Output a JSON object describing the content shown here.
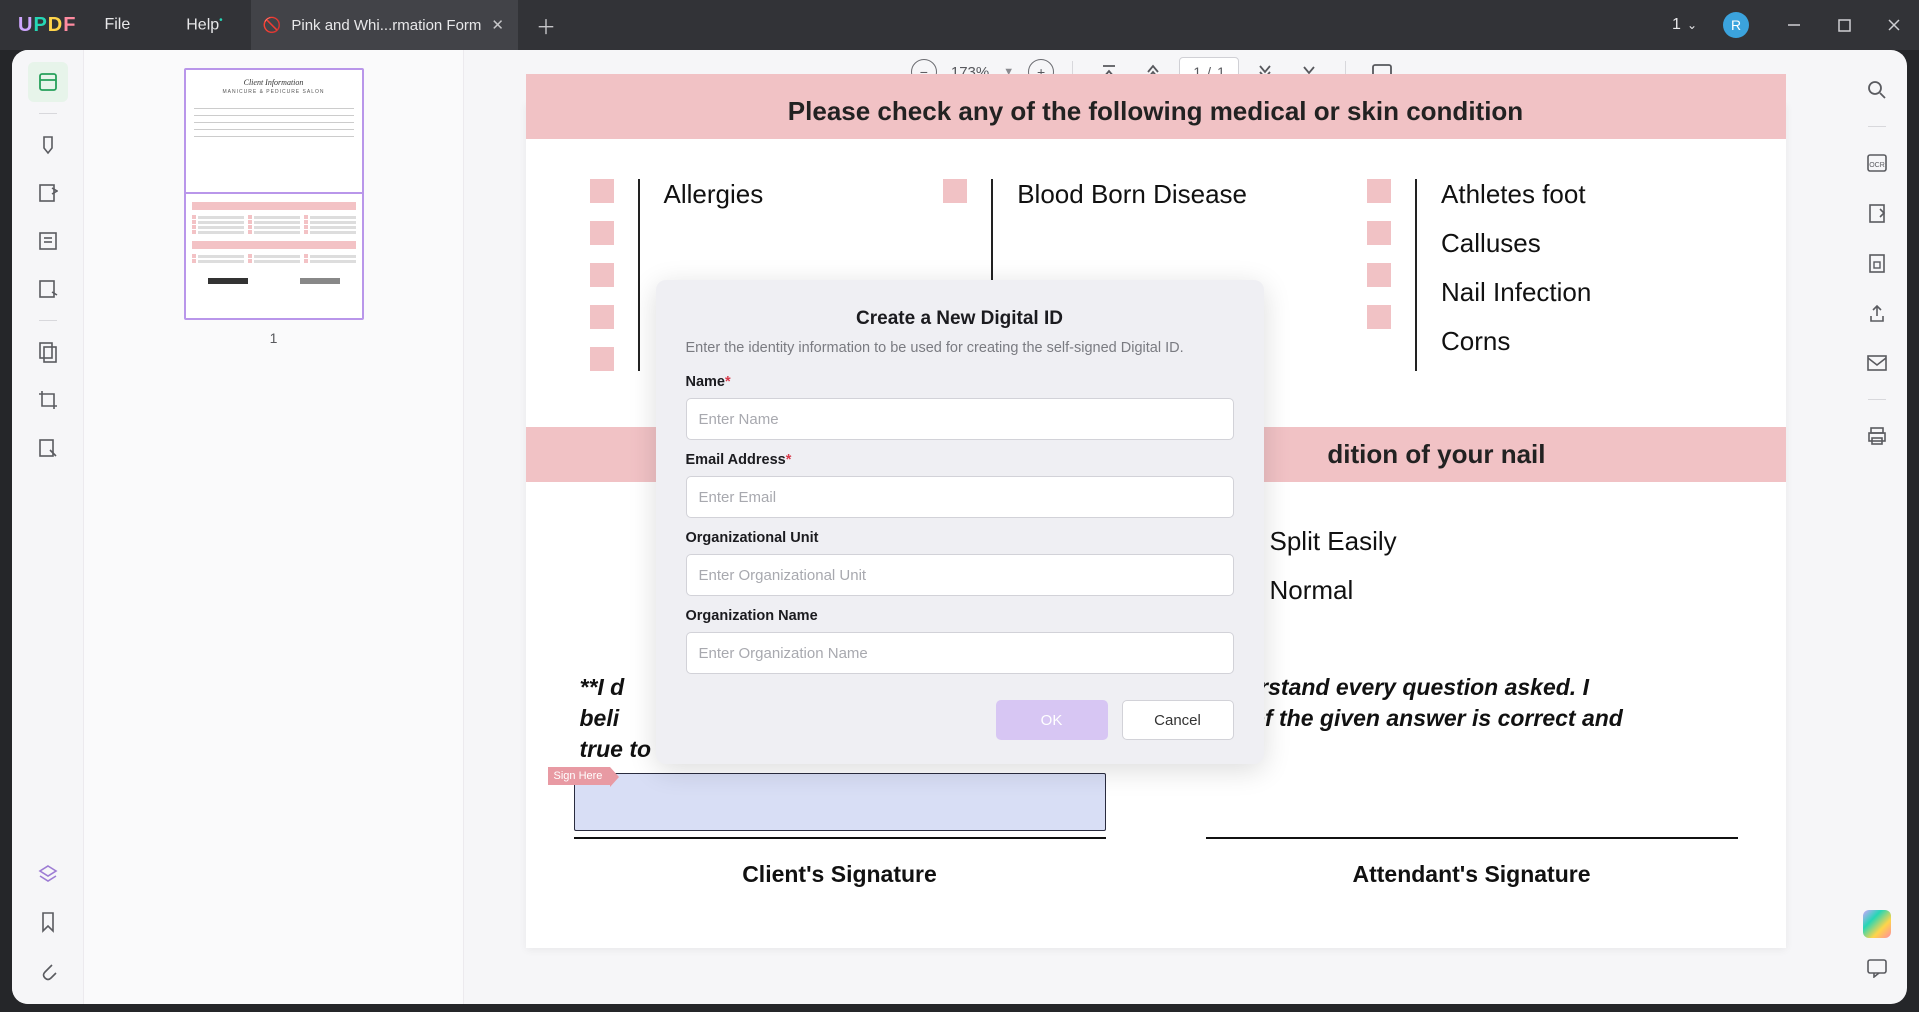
{
  "titlebar": {
    "menu_file": "File",
    "menu_help": "Help",
    "tab_title": "Pink and Whi...rmation Form",
    "window_count": "1",
    "avatar_letter": "R"
  },
  "toolbar": {
    "zoom": "173%",
    "page_current": "1",
    "page_sep": "/",
    "page_total": "1"
  },
  "thumbnail": {
    "page_num": "1",
    "doc_title_1": "Client Information",
    "doc_title_2": "MANICURE & PEDICURE SALON"
  },
  "document": {
    "banner_medical": "Please check any of the following medical or skin condition",
    "banner_nail_suffix": "dition of your nail",
    "medical": {
      "col1": [
        "Allergies"
      ],
      "col2": [
        "Blood Born Disease"
      ],
      "col3": [
        "Athletes foot",
        "Calluses",
        "Nail Infection",
        "Corns"
      ]
    },
    "nail": {
      "col1": [
        "Split Easily",
        "Normal"
      ]
    },
    "disclaimer_l1_pre": "**I d",
    "disclaimer_l1_post": "understand every question asked. I",
    "disclaimer_l2_pre": "beli",
    "disclaimer_l2_post": "All of the given answer is correct and",
    "disclaimer_l3": "true to the best of my knowledge.",
    "sign_here": "Sign Here",
    "client_sig": "Client's Signature",
    "attendant_sig": "Attendant's Signature"
  },
  "dialog": {
    "title": "Create a New Digital ID",
    "subtitle": "Enter the identity information to be used for creating the self-signed Digital ID.",
    "labels": {
      "name": "Name",
      "email": "Email Address",
      "org_unit": "Organizational Unit",
      "org_name": "Organization Name"
    },
    "placeholders": {
      "name": "Enter Name",
      "email": "Enter Email",
      "org_unit": "Enter Organizational Unit",
      "org_name": "Enter Organization Name"
    },
    "ok": "OK",
    "cancel": "Cancel"
  }
}
